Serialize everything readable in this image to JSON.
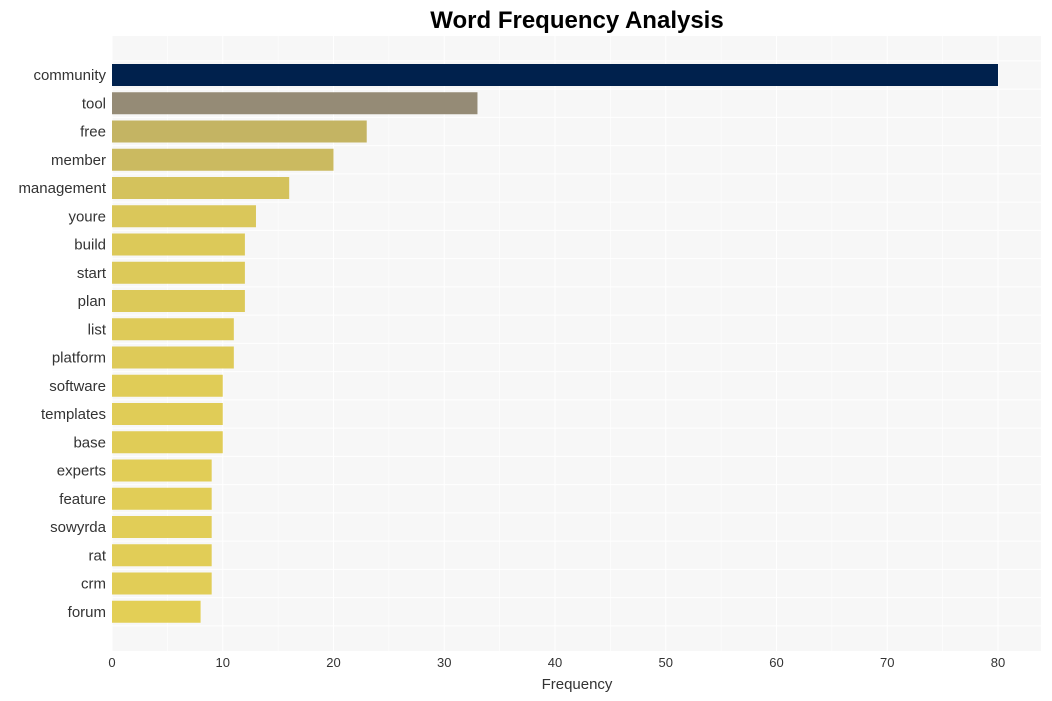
{
  "chart_data": {
    "type": "bar",
    "orientation": "horizontal",
    "title": "Word Frequency Analysis",
    "xlabel": "Frequency",
    "ylabel": "",
    "xlim": [
      0,
      84
    ],
    "xticks": [
      0,
      10,
      20,
      30,
      40,
      50,
      60,
      70,
      80
    ],
    "grid": true,
    "legend": "none",
    "categories": [
      "community",
      "tool",
      "free",
      "member",
      "management",
      "youre",
      "build",
      "start",
      "plan",
      "list",
      "platform",
      "software",
      "templates",
      "base",
      "experts",
      "feature",
      "sowyrda",
      "rat",
      "crm",
      "forum"
    ],
    "values": [
      80,
      33,
      23,
      20,
      16,
      13,
      12,
      12,
      12,
      11,
      11,
      10,
      10,
      10,
      9,
      9,
      9,
      9,
      9,
      8
    ],
    "colors": {
      "max_bar": "#00214d",
      "gradient_high": "#958b76",
      "gradient_low": "#e3cf56",
      "plot_background": "#f7f7f7",
      "grid": "#ffffff"
    }
  }
}
